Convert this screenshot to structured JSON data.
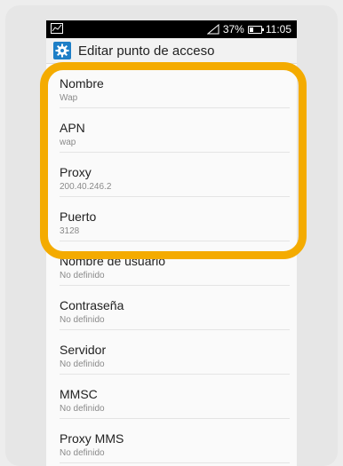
{
  "status_bar": {
    "battery_percent": "37%",
    "battery_level": 0.37,
    "time": "11:05",
    "notification_icon": "activity-icon",
    "signal_icon": "signal-icon"
  },
  "action_bar": {
    "title": "Editar punto de acceso",
    "icon": "settings-gear-icon"
  },
  "settings": [
    {
      "title": "Nombre",
      "value": "Wap"
    },
    {
      "title": "APN",
      "value": "wap"
    },
    {
      "title": "Proxy",
      "value": "200.40.246.2"
    },
    {
      "title": "Puerto",
      "value": "3128"
    },
    {
      "title": "Nombre de usuario",
      "value": "No definido"
    },
    {
      "title": "Contraseña",
      "value": "No definido"
    },
    {
      "title": "Servidor",
      "value": "No definido"
    },
    {
      "title": "MMSC",
      "value": "No definido"
    },
    {
      "title": "Proxy MMS",
      "value": "No definido"
    }
  ],
  "highlight_color": "#f4ab00"
}
